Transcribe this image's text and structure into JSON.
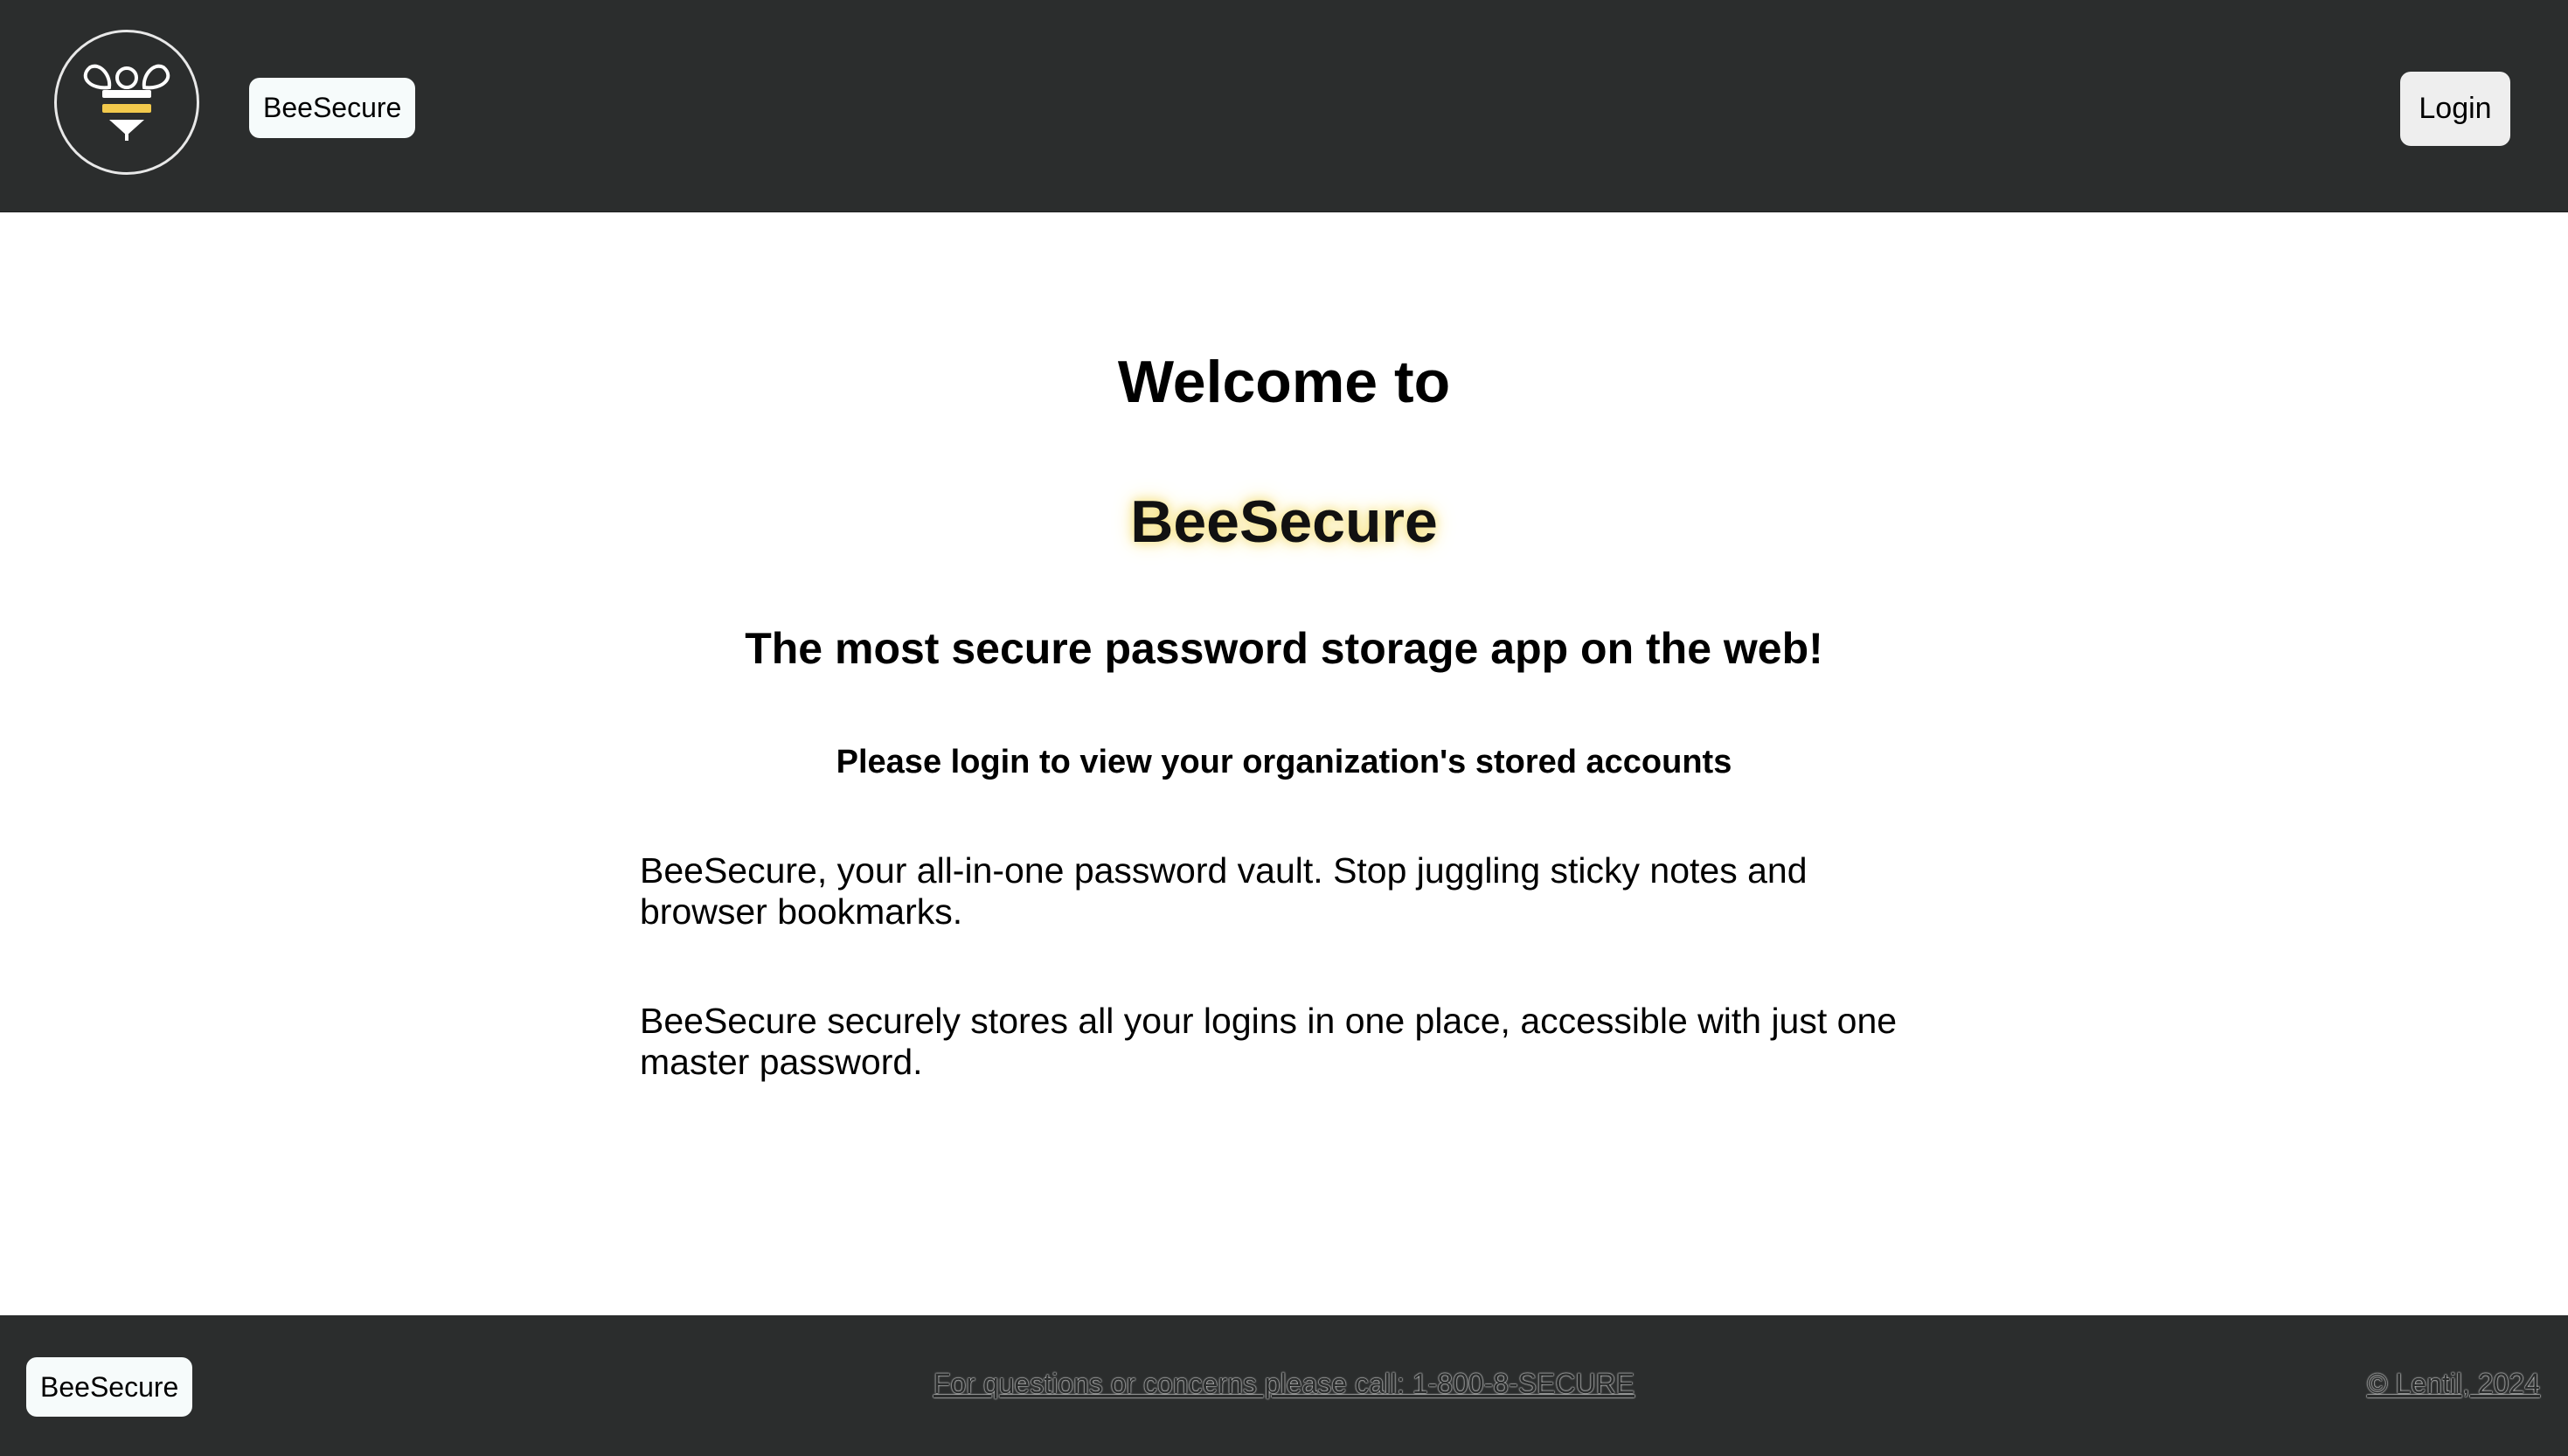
{
  "header": {
    "brand_label": "BeeSecure",
    "login_label": "Login",
    "logo_icon": "bee-logo-icon"
  },
  "main": {
    "welcome": "Welcome to",
    "brand_title": "BeeSecure",
    "tagline": "The most secure password storage app on the web!",
    "login_prompt": "Please login to view your organization's stored accounts",
    "paragraphs": [
      "BeeSecure, your all-in-one password vault. Stop juggling sticky notes and browser bookmarks.",
      "BeeSecure securely stores all your logins in one place, accessible with just one master password."
    ]
  },
  "footer": {
    "brand_label": "BeeSecure",
    "contact": "For questions or concerns please call: 1-800-8-SECURE",
    "copyright": "© Lentil, 2024"
  },
  "colors": {
    "header_bg": "#2b2d2d",
    "accent_yellow": "#f2c94c",
    "glow": "#f5dd74"
  }
}
